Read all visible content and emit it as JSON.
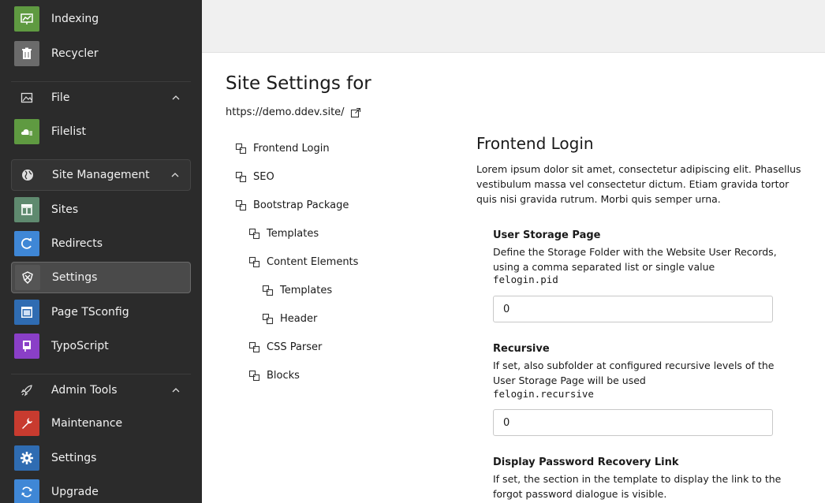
{
  "sidebar": {
    "items": [
      {
        "label": "Indexing",
        "color": "#5f9a41"
      },
      {
        "label": "Recycler",
        "color": "#6b6b6b"
      },
      {
        "label": "File",
        "section": true
      },
      {
        "label": "Filelist",
        "color": "#5f9a41"
      },
      {
        "label": "Site Management",
        "section": true
      },
      {
        "label": "Sites",
        "color": "#5f8a6f"
      },
      {
        "label": "Redirects",
        "color": "#3f87d6"
      },
      {
        "label": "Settings",
        "color": "#555555",
        "selected": true
      },
      {
        "label": "Page TSconfig",
        "color": "#2f6cb2"
      },
      {
        "label": "TypoScript",
        "color": "#8a3fc7"
      },
      {
        "label": "Admin Tools",
        "section": true
      },
      {
        "label": "Maintenance",
        "color": "#c83b2f"
      },
      {
        "label": "Settings",
        "color": "#2f6cb2"
      },
      {
        "label": "Upgrade",
        "color": "#3f87d6"
      }
    ]
  },
  "main": {
    "title": "Site Settings for",
    "url": "https://demo.ddev.site/",
    "tree": [
      {
        "label": "Frontend Login",
        "level": 0
      },
      {
        "label": "SEO",
        "level": 0
      },
      {
        "label": "Bootstrap Package",
        "level": 0
      },
      {
        "label": "Templates",
        "level": 1
      },
      {
        "label": "Content Elements",
        "level": 1
      },
      {
        "label": "Templates",
        "level": 2
      },
      {
        "label": "Header",
        "level": 2
      },
      {
        "label": "CSS Parser",
        "level": 1
      },
      {
        "label": "Blocks",
        "level": 1
      }
    ],
    "section": {
      "heading": "Frontend Login",
      "description": "Lorem ipsum dolor sit amet, consectetur adipiscing elit. Phasellus vestibulum massa vel consectetur dictum. Etiam gravida tortor quis nisi gravida rutrum. Morbi quis semper urna."
    },
    "settings": [
      {
        "label": "User Storage Page",
        "description": "Define the Storage Folder with the Website User Records, using a comma separated list or single value",
        "key": "felogin.pid",
        "value": "0"
      },
      {
        "label": "Recursive",
        "description": "If set, also subfolder at configured recursive levels of the User Storage Page will be used",
        "key": "felogin.recursive",
        "value": "0"
      },
      {
        "label": "Display Password Recovery Link",
        "description": "If set, the section in the template to display the link to the forgot password dialogue is visible."
      }
    ]
  }
}
